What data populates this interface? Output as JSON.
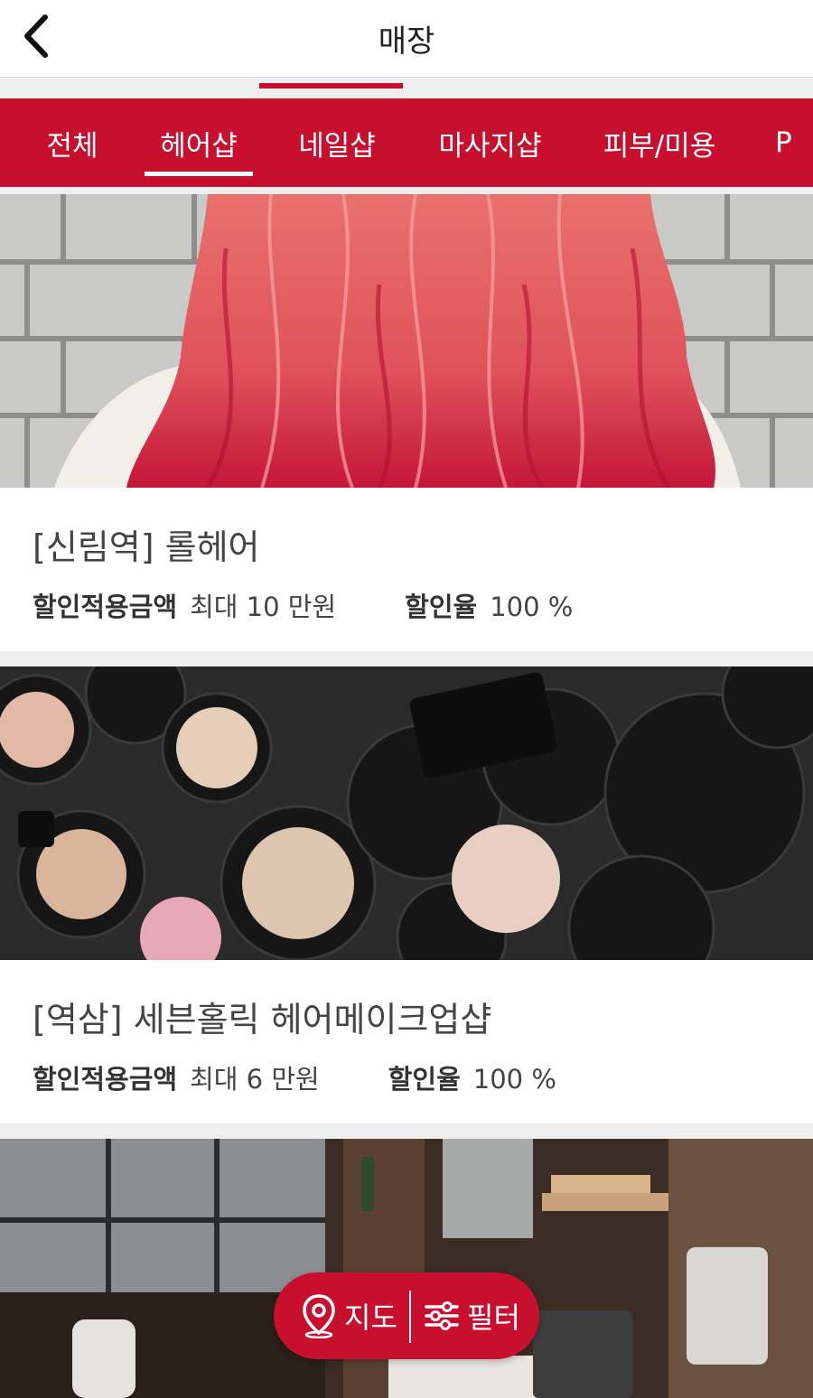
{
  "header": {
    "title": "매장",
    "back_icon": "chevron-left-icon"
  },
  "tabs": [
    {
      "label": "전체",
      "active": false
    },
    {
      "label": "헤어샵",
      "active": true
    },
    {
      "label": "네일샵",
      "active": false
    },
    {
      "label": "마사지샵",
      "active": false
    },
    {
      "label": "피부/미용",
      "active": false
    },
    {
      "label": "P",
      "active": false
    }
  ],
  "stores": [
    {
      "title": "[신림역] 롤헤어",
      "amount_label": "할인적용금액",
      "amount_value": "최대 10 만원",
      "rate_label": "할인율",
      "rate_value": "100 %",
      "image": "red-wavy-hair-photo"
    },
    {
      "title": "[역삼] 세븐홀릭 헤어메이크업샵",
      "amount_label": "할인적용금액",
      "amount_value": "최대 6 만원",
      "rate_label": "할인율",
      "rate_value": "100 %",
      "image": "makeup-compacts-photo"
    },
    {
      "image": "barber-shop-interior-photo"
    }
  ],
  "fab": {
    "map_label": "지도",
    "filter_label": "필터",
    "map_icon": "map-pin-icon",
    "filter_icon": "sliders-icon"
  },
  "colors": {
    "brand": "#c8102e",
    "background": "#efefef"
  }
}
